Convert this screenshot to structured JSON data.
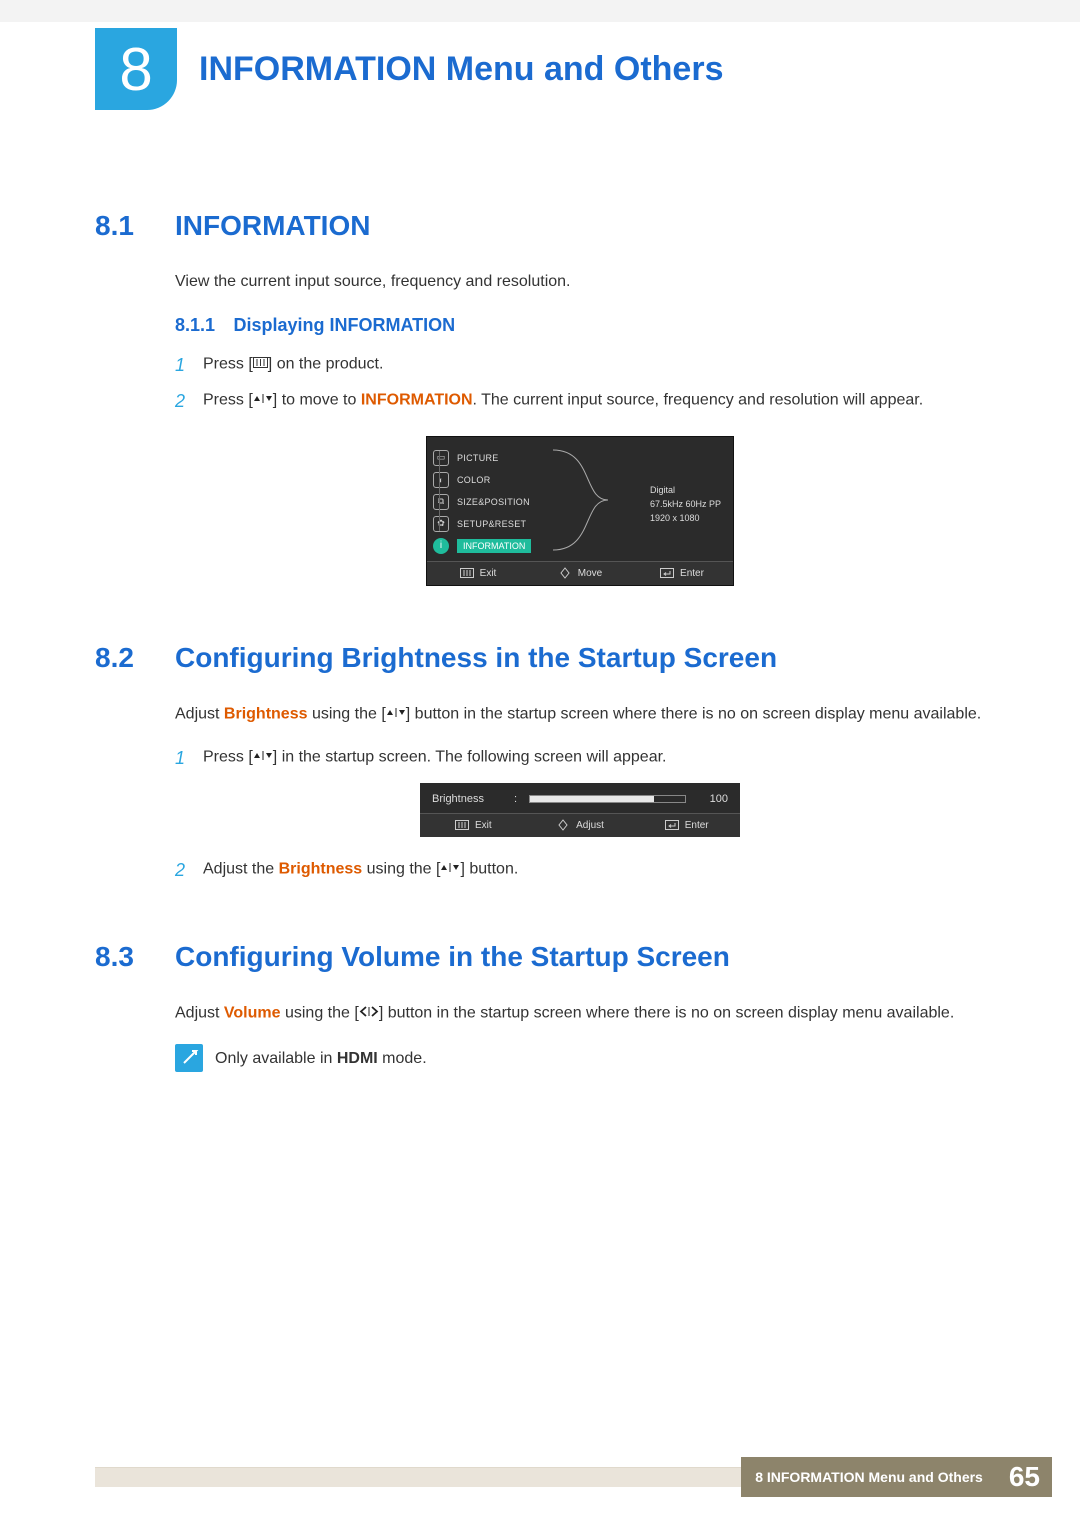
{
  "chapter": {
    "number": "8",
    "title": "INFORMATION Menu and Others"
  },
  "sec81": {
    "num": "8.1",
    "title": "INFORMATION",
    "intro": "View the current input source, frequency and resolution.",
    "sub": {
      "num": "8.1.1",
      "title": "Displaying INFORMATION"
    },
    "step1_pre": "Press [",
    "step1_post": "] on the product.",
    "step2_pre": "Press [",
    "step2_mid1": "] to move to ",
    "step2_kw": "INFORMATION",
    "step2_post": ". The current input source, frequency and resolution will appear."
  },
  "osd1": {
    "items": [
      {
        "icon": "▭",
        "label": "PICTURE"
      },
      {
        "icon": "◐",
        "label": "COLOR"
      },
      {
        "icon": "⧉",
        "label": "SIZE&POSITION"
      },
      {
        "icon": "✿",
        "label": "SETUP&RESET"
      }
    ],
    "selected": {
      "icon": "i",
      "label": "INFORMATION"
    },
    "info": {
      "l1": "Digital",
      "l2": "67.5kHz 60Hz PP",
      "l3": "1920 x 1080"
    },
    "foot": {
      "exit": "Exit",
      "move": "Move",
      "enter": "Enter"
    }
  },
  "sec82": {
    "num": "8.2",
    "title": "Configuring Brightness in the Startup Screen",
    "intro_pre": "Adjust ",
    "intro_kw": "Brightness",
    "intro_mid": " using the [",
    "intro_post": "] button in the startup screen where there is no on screen display menu available.",
    "step1_pre": "Press [",
    "step1_post": "] in the startup screen. The following screen will appear.",
    "step2_pre": "Adjust the ",
    "step2_kw": "Brightness",
    "step2_mid": " using the [",
    "step2_post": "] button."
  },
  "osd2": {
    "label": "Brightness",
    "value": "100",
    "fill_pct": 80,
    "foot": {
      "exit": "Exit",
      "adjust": "Adjust",
      "enter": "Enter"
    }
  },
  "sec83": {
    "num": "8.3",
    "title": "Configuring Volume in the Startup Screen",
    "intro_pre": "Adjust ",
    "intro_kw": "Volume",
    "intro_mid": " using the [",
    "intro_post": "] button in the startup screen where there is no on screen display menu available.",
    "note_pre": "Only available in ",
    "note_kw": "HDMI",
    "note_post": " mode."
  },
  "footer": {
    "label": "8 INFORMATION Menu and Others",
    "page": "65"
  },
  "step_nums": {
    "s1": "1",
    "s2": "2"
  }
}
